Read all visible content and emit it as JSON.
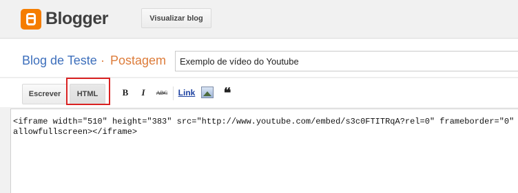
{
  "header": {
    "logo_text": "Blogger",
    "view_blog_label": "Visualizar blog",
    "brand_color": "#f57d00"
  },
  "title_row": {
    "blog_name": "Blog de Teste",
    "separator": "·",
    "section": "Postagem",
    "post_title_value": "Exemplo de vídeo do Youtube"
  },
  "toolbar": {
    "compose_label": "Escrever",
    "html_label": "HTML",
    "bold_label": "B",
    "italic_label": "I",
    "strike_label": "ABC",
    "link_label": "Link",
    "image_icon": "image-icon",
    "quote_label": "❝",
    "highlight_color": "#d92020"
  },
  "editor": {
    "content": "<iframe width=\"510\" height=\"383\" src=\"http://www.youtube.com/embed/s3c0FTITRqA?rel=0\" frameborder=\"0\" allowfullscreen></iframe>"
  }
}
